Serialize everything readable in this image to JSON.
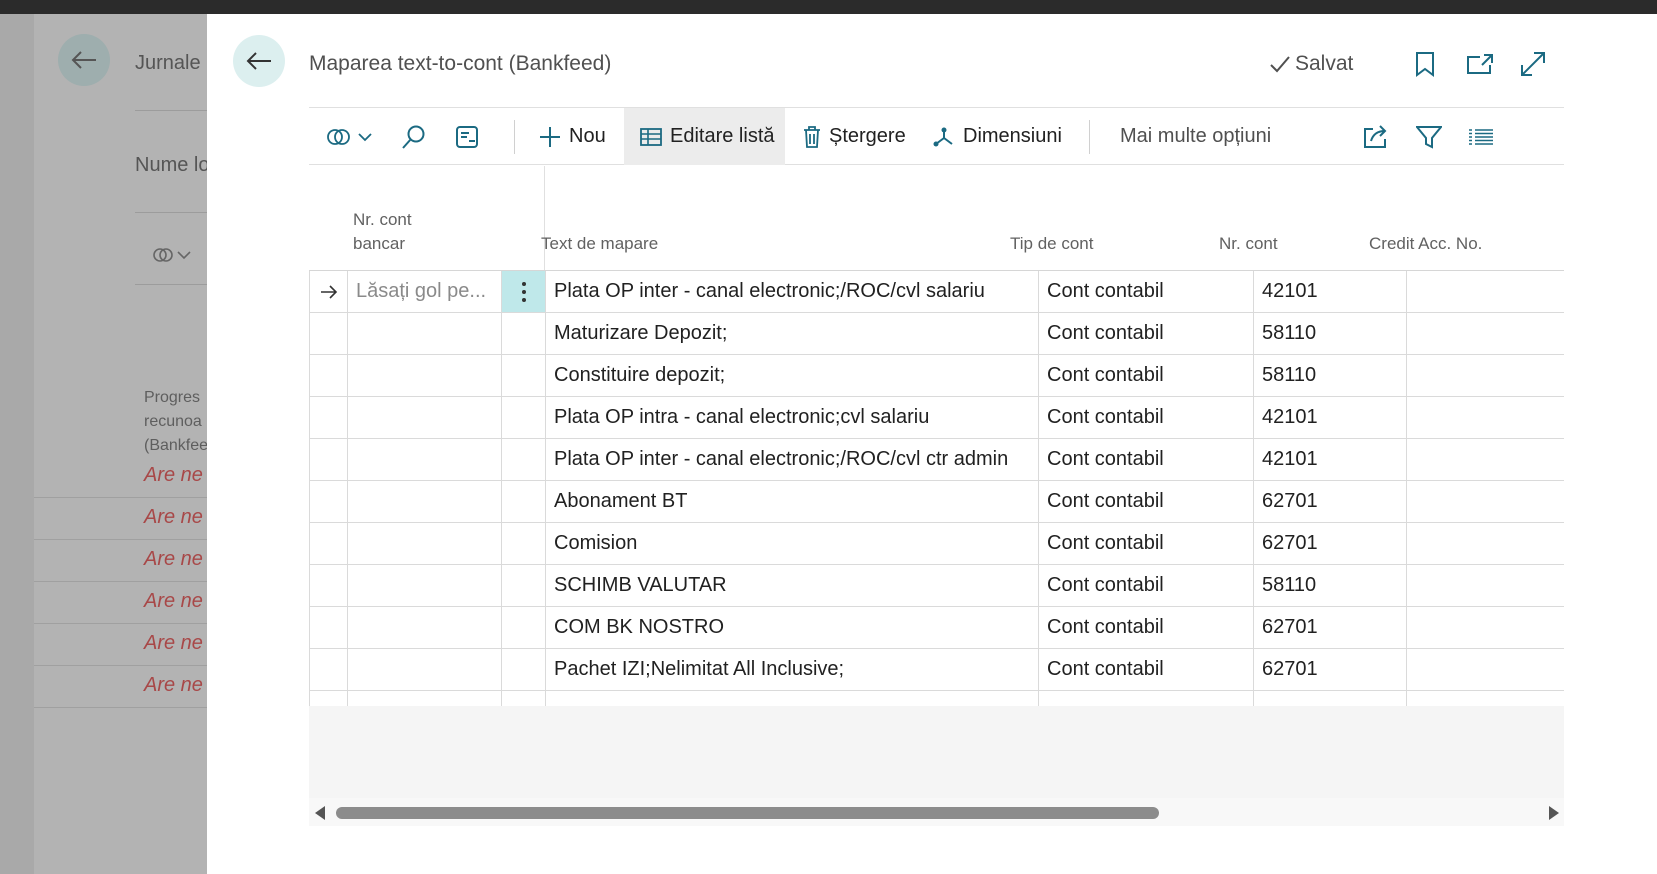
{
  "background": {
    "title": "Jurnale",
    "name_label": "Nume lo",
    "progress_label": [
      "Progres",
      "recunoa",
      "(Bankfee"
    ],
    "rows": [
      "Are ne",
      "Are ne",
      "Are ne",
      "Are ne",
      "Are ne",
      "Are ne"
    ]
  },
  "dialog": {
    "title": "Maparea text-to-cont (Bankfeed)",
    "saved_label": "Salvat"
  },
  "toolbar": {
    "new_label": "Nou",
    "edit_list_label": "Editare listă",
    "delete_label": "Ștergere",
    "dimensions_label": "Dimensiuni",
    "more_label": "Mai multe opțiuni"
  },
  "grid": {
    "headers": {
      "bank_account_line1": "Nr. cont",
      "bank_account_line2": "bancar",
      "mapping_text": "Text de mapare",
      "account_type": "Tip de cont",
      "account_no": "Nr. cont",
      "credit_acc_no": "Credit Acc. No."
    },
    "placeholder": "Lăsați gol pe...",
    "rows": [
      {
        "text": "Plata OP inter - canal electronic;/ROC/cvl salariu",
        "type": "Cont contabil",
        "account": "42101",
        "credit": ""
      },
      {
        "text": "Maturizare Depozit;",
        "type": "Cont contabil",
        "account": "58110",
        "credit": ""
      },
      {
        "text": "Constituire depozit;",
        "type": "Cont contabil",
        "account": "58110",
        "credit": ""
      },
      {
        "text": "Plata OP intra - canal electronic;cvl salariu",
        "type": "Cont contabil",
        "account": "42101",
        "credit": ""
      },
      {
        "text": "Plata OP inter - canal electronic;/ROC/cvl ctr admin",
        "type": "Cont contabil",
        "account": "42101",
        "credit": ""
      },
      {
        "text": "Abonament BT",
        "type": "Cont contabil",
        "account": "62701",
        "credit": ""
      },
      {
        "text": "Comision",
        "type": "Cont contabil",
        "account": "62701",
        "credit": ""
      },
      {
        "text": "SCHIMB VALUTAR",
        "type": "Cont contabil",
        "account": "58110",
        "credit": ""
      },
      {
        "text": "COM BK NOSTRO",
        "type": "Cont contabil",
        "account": "62701",
        "credit": ""
      },
      {
        "text": "Pachet IZI;Nelimitat All Inclusive;",
        "type": "Cont contabil",
        "account": "62701",
        "credit": ""
      },
      {
        "text": "",
        "type": "",
        "account": "",
        "credit": ""
      }
    ]
  }
}
